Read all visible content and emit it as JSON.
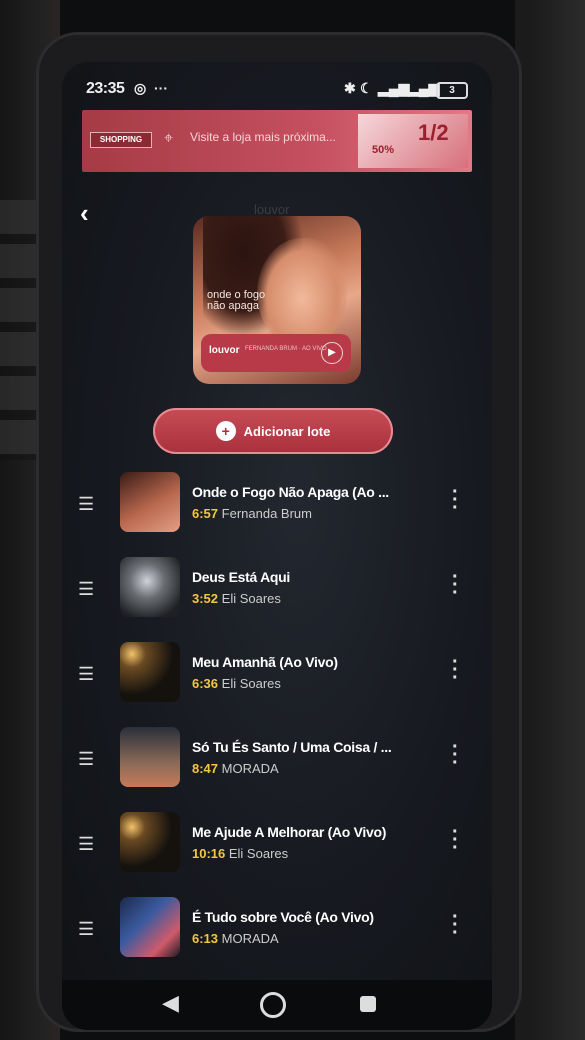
{
  "status_bar": {
    "time": "23:35",
    "battery": "3"
  },
  "ad": {
    "brand": "SHOPPING",
    "text": "Visite a loja mais próxima...",
    "promo_pct": "50%",
    "promo_big": "1/2"
  },
  "header": {
    "title": "louvor"
  },
  "cover": {
    "title_line1": "onde o fogo",
    "title_line2": "não apaga",
    "label": "louvor",
    "sub": "FERNANDA BRUM · AO VIVO"
  },
  "add_button": {
    "label": "Adicionar lote"
  },
  "tracks": [
    {
      "title": "Onde o Fogo Não Apaga (Ao ...",
      "duration": "6:57",
      "artist": "Fernanda Brum"
    },
    {
      "title": "Deus Está Aqui",
      "duration": "3:52",
      "artist": "Eli Soares"
    },
    {
      "title": "Meu Amanhã (Ao Vivo)",
      "duration": "6:36",
      "artist": "Eli Soares"
    },
    {
      "title": "Só Tu És Santo / Uma Coisa / ...",
      "duration": "8:47",
      "artist": "MORADA"
    },
    {
      "title": "Me Ajude A Melhorar (Ao Vivo)",
      "duration": "10:16",
      "artist": "Eli Soares"
    },
    {
      "title": "É Tudo sobre Você (Ao Vivo)",
      "duration": "6:13",
      "artist": "MORADA"
    }
  ]
}
